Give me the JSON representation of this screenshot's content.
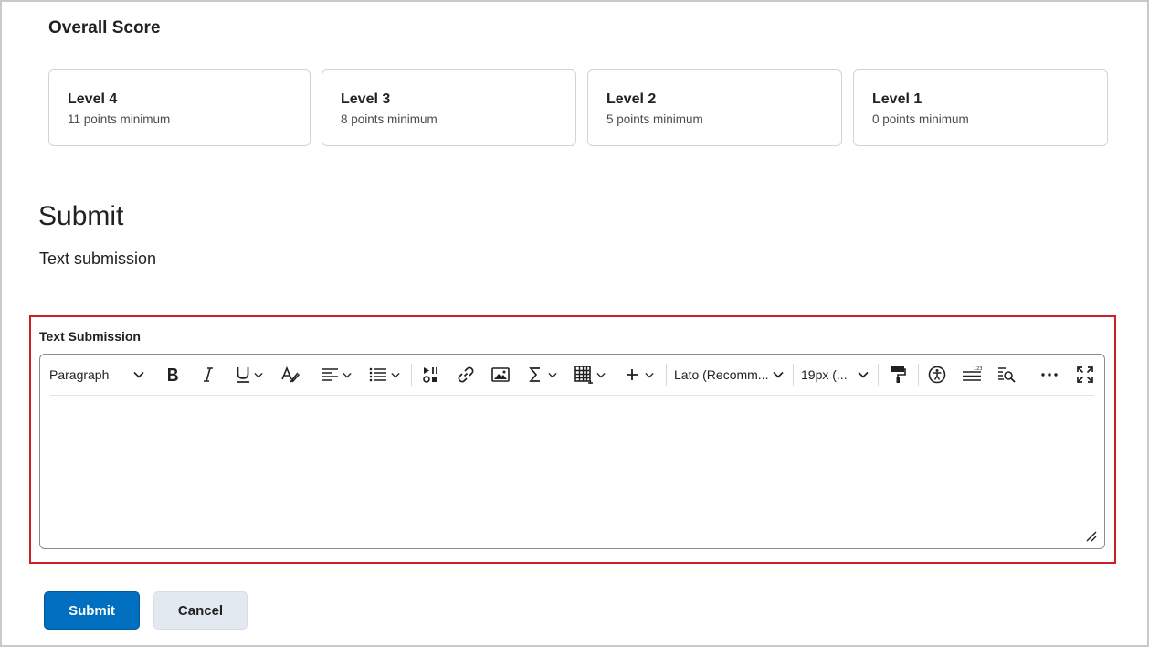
{
  "overall_score": {
    "title": "Overall Score",
    "levels": [
      {
        "name": "Level 4",
        "minimum": "11 points minimum"
      },
      {
        "name": "Level 3",
        "minimum": "8 points minimum"
      },
      {
        "name": "Level 2",
        "minimum": "5 points minimum"
      },
      {
        "name": "Level 1",
        "minimum": "0 points minimum"
      }
    ]
  },
  "submit_section": {
    "heading": "Submit",
    "subheading": "Text submission",
    "field_label": "Text Submission",
    "editor": {
      "block_format": "Paragraph",
      "font_family": "Lato (Recomm...",
      "font_size": "19px (...",
      "body": ""
    }
  },
  "actions": {
    "submit_label": "Submit",
    "cancel_label": "Cancel"
  },
  "colors": {
    "primary_button": "#006fbf",
    "highlight_border": "#cd2026",
    "secondary_button": "#e3e9f1"
  }
}
